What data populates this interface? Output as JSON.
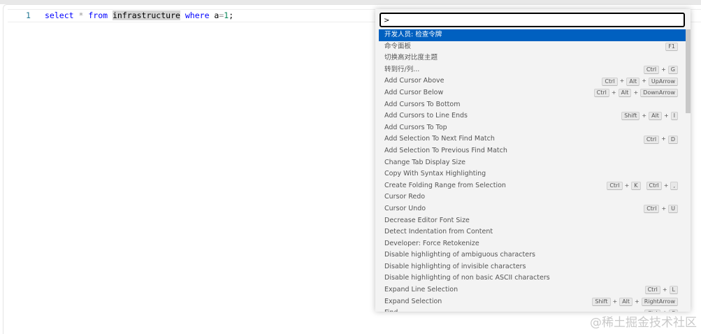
{
  "editor": {
    "line_number": "1",
    "tokens": [
      [
        "select",
        "kw"
      ],
      [
        " ",
        ""
      ],
      [
        "*",
        "op"
      ],
      [
        " ",
        ""
      ],
      [
        "from",
        "kw"
      ],
      [
        " ",
        ""
      ],
      [
        "infrastructure",
        "hl"
      ],
      [
        " ",
        ""
      ],
      [
        "where",
        "kw"
      ],
      [
        " a",
        ""
      ],
      [
        "=",
        "op"
      ],
      [
        "1",
        "num"
      ],
      [
        ";",
        ""
      ]
    ]
  },
  "palette": {
    "input_value": ">",
    "items": [
      {
        "label": "开发人员: 检查令牌",
        "keys": []
      },
      {
        "label": "命令面板",
        "keys": [
          [
            "F1"
          ]
        ]
      },
      {
        "label": "切换高对比度主题",
        "keys": []
      },
      {
        "label": "转到行/列...",
        "keys": [
          [
            "Ctrl",
            "G"
          ]
        ]
      },
      {
        "label": "Add Cursor Above",
        "keys": [
          [
            "Ctrl",
            "Alt",
            "UpArrow"
          ]
        ]
      },
      {
        "label": "Add Cursor Below",
        "keys": [
          [
            "Ctrl",
            "Alt",
            "DownArrow"
          ]
        ]
      },
      {
        "label": "Add Cursors To Bottom",
        "keys": []
      },
      {
        "label": "Add Cursors to Line Ends",
        "keys": [
          [
            "Shift",
            "Alt",
            "I"
          ]
        ]
      },
      {
        "label": "Add Cursors To Top",
        "keys": []
      },
      {
        "label": "Add Selection To Next Find Match",
        "keys": [
          [
            "Ctrl",
            "D"
          ]
        ]
      },
      {
        "label": "Add Selection To Previous Find Match",
        "keys": []
      },
      {
        "label": "Change Tab Display Size",
        "keys": []
      },
      {
        "label": "Copy With Syntax Highlighting",
        "keys": []
      },
      {
        "label": "Create Folding Range from Selection",
        "keys": [
          [
            "Ctrl",
            "K"
          ],
          [
            "Ctrl",
            ","
          ]
        ]
      },
      {
        "label": "Cursor Redo",
        "keys": []
      },
      {
        "label": "Cursor Undo",
        "keys": [
          [
            "Ctrl",
            "U"
          ]
        ]
      },
      {
        "label": "Decrease Editor Font Size",
        "keys": []
      },
      {
        "label": "Detect Indentation from Content",
        "keys": []
      },
      {
        "label": "Developer: Force Retokenize",
        "keys": []
      },
      {
        "label": "Disable highlighting of ambiguous characters",
        "keys": []
      },
      {
        "label": "Disable highlighting of invisible characters",
        "keys": []
      },
      {
        "label": "Disable highlighting of non basic ASCII characters",
        "keys": []
      },
      {
        "label": "Expand Line Selection",
        "keys": [
          [
            "Ctrl",
            "L"
          ]
        ]
      },
      {
        "label": "Expand Selection",
        "keys": [
          [
            "Shift",
            "Alt",
            "RightArrow"
          ]
        ]
      },
      {
        "label": "Find",
        "keys": [
          [
            "Ctrl",
            "F"
          ]
        ]
      }
    ]
  },
  "watermark": "@稀土掘金技术社区"
}
